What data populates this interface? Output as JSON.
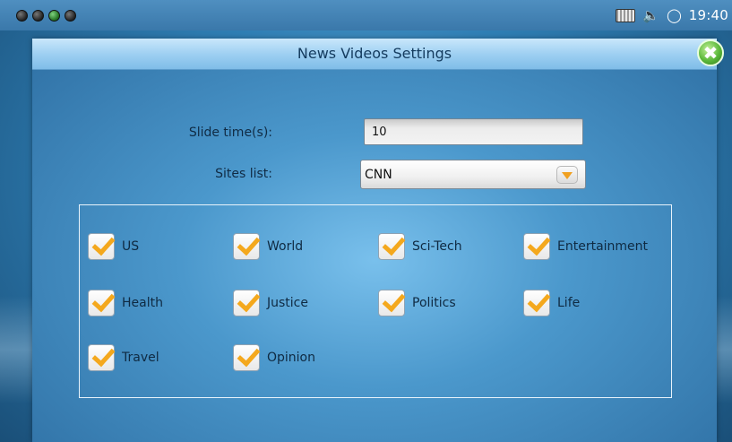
{
  "statusbar": {
    "clock": "19:40",
    "icons": [
      "keyboard-icon",
      "volume-icon",
      "sync-icon"
    ]
  },
  "dialog": {
    "title": "News Videos Settings",
    "close_icon": "close-icon",
    "slide_time_label": "Slide time(s):",
    "slide_time_value": "10",
    "sites_list_label": "Sites list:",
    "sites_list_value": "CNN",
    "categories": [
      {
        "label": "US",
        "checked": true
      },
      {
        "label": "World",
        "checked": true
      },
      {
        "label": "Sci-Tech",
        "checked": true
      },
      {
        "label": "Entertainment",
        "checked": true
      },
      {
        "label": "Health",
        "checked": true
      },
      {
        "label": "Justice",
        "checked": true
      },
      {
        "label": "Politics",
        "checked": true
      },
      {
        "label": "Life",
        "checked": true
      },
      {
        "label": "Travel",
        "checked": true
      },
      {
        "label": "Opinion",
        "checked": true
      }
    ]
  },
  "colors": {
    "accent_check": "#f4a81d",
    "close_green": "#5bb83a",
    "title_text": "#143b5e"
  }
}
